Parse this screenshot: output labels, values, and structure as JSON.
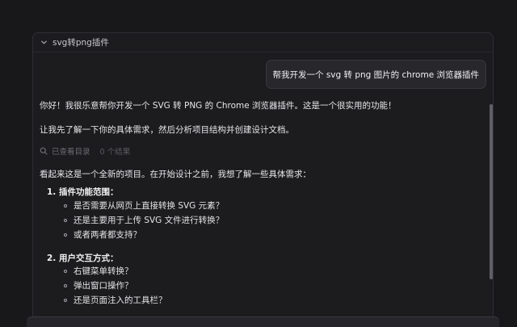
{
  "panel": {
    "title": "svg转png插件"
  },
  "conversation": {
    "user_message": "帮我开发一个 svg 转 png 图片的 chrome 浏览器插件",
    "greeting": "你好！我很乐意帮你开发一个 SVG 转 PNG 的 Chrome 浏览器插件。这是一个很实用的功能！",
    "plan": "让我先了解一下你的具体需求，然后分析项目结构并创建设计文档。",
    "tool_call": {
      "label": "已查看目录",
      "result": "0 个结果"
    },
    "intro": "看起来这是一个全新的项目。在开始设计之前，我想了解一些具体需求：",
    "sections": [
      {
        "heading": "1. 插件功能范围：",
        "items": [
          "是否需要从网页上直接转换 SVG 元素？",
          "还是主要用于上传 SVG 文件进行转换？",
          "或者两者都支持？"
        ]
      },
      {
        "heading": "2. 用户交互方式：",
        "items": [
          "右键菜单转换？",
          "弹出窗口操作？",
          "还是页面注入的工具栏？"
        ]
      }
    ]
  },
  "icons": {
    "collapse": "chevron-down-icon",
    "search": "search-icon"
  }
}
